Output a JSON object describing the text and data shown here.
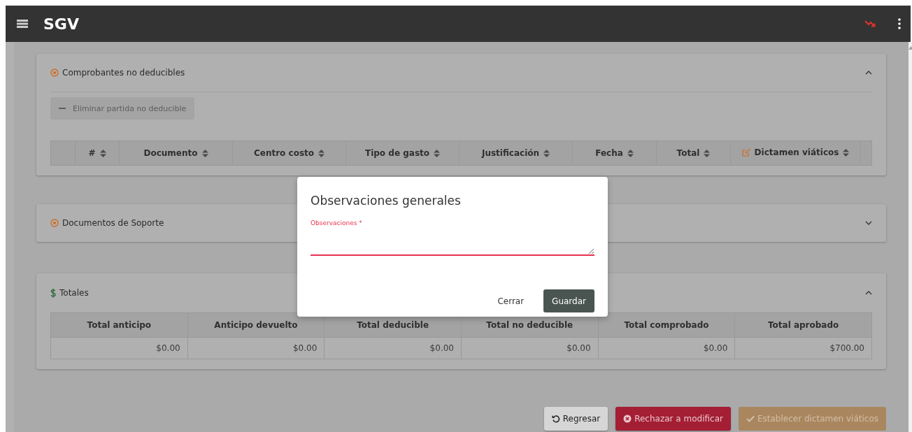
{
  "app_bar": {
    "title": "SGV"
  },
  "sections": [
    {
      "kind": "records",
      "title": "Comprobantes no deducibles",
      "expanded": true,
      "action": {
        "label": "Eliminar partida no deducible",
        "disabled": true
      },
      "columns": [
        {
          "sortable": false
        },
        {
          "label": "#",
          "sortable": true
        },
        {
          "label": "Documento",
          "sortable": true
        },
        {
          "label": "Centro costo",
          "sortable": true
        },
        {
          "label": "Tipo de gasto",
          "sortable": true
        },
        {
          "label": "Justificación",
          "sortable": true
        },
        {
          "label": "Fecha",
          "sortable": true
        },
        {
          "label": "Total",
          "sortable": true
        },
        {
          "label": "Dictamen viáticos",
          "sortable": true,
          "editable": true
        },
        {
          "sortable": false
        }
      ]
    },
    {
      "kind": "documents",
      "title": "Documentos de Soporte",
      "expanded": false
    },
    {
      "kind": "totals",
      "title": "Totales",
      "expanded": true,
      "columns": [
        {
          "label": "Total anticipo"
        },
        {
          "label": "Anticipo devuelto"
        },
        {
          "label": "Total deducible"
        },
        {
          "label": "Total no deducible"
        },
        {
          "label": "Total comprobado"
        },
        {
          "label": "Total aprobado"
        }
      ],
      "rows": [
        [
          "$0.00",
          "$0.00",
          "$0.00",
          "$0.00",
          "$0.00",
          "$700.00"
        ]
      ]
    }
  ],
  "footer_buttons": [
    {
      "kind": "back",
      "label": "Regresar",
      "disabled": false
    },
    {
      "kind": "reject",
      "label": "Rechazar a modificar",
      "disabled": false
    },
    {
      "kind": "confirm",
      "label": "Establecer dictamen viáticos",
      "disabled": true
    }
  ],
  "dialog": {
    "title": "Observaciones generales",
    "field": {
      "label": "Observaciones *",
      "invalid": true
    },
    "buttons": [
      {
        "kind": "flat",
        "label": "Cerrar"
      },
      {
        "kind": "primary",
        "label": "Guardar"
      }
    ]
  }
}
